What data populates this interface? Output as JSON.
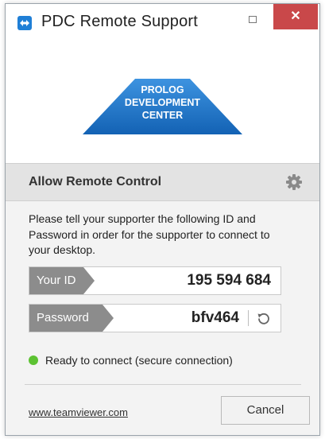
{
  "window": {
    "title": "PDC Remote Support",
    "close_glyph": "✕",
    "logo_lines": [
      "PROLOG",
      "DEVELOPMENT",
      "CENTER"
    ]
  },
  "section": {
    "title": "Allow Remote Control",
    "settings_icon": "gear-icon"
  },
  "instructions": "Please tell your supporter the following ID and Password in order for the supporter to connect to your desktop.",
  "credentials": {
    "id_label": "Your ID",
    "id_value": "195 594 684",
    "password_label": "Password",
    "password_value": "bfv464"
  },
  "status": {
    "text": "Ready to connect (secure connection)",
    "color": "#5cc232"
  },
  "footer": {
    "link": "www.teamviewer.com",
    "cancel_label": "Cancel"
  },
  "colors": {
    "close_button": "#c9484a",
    "logo_blue": "#1a73c8",
    "label_gray": "#8c8c8c"
  }
}
